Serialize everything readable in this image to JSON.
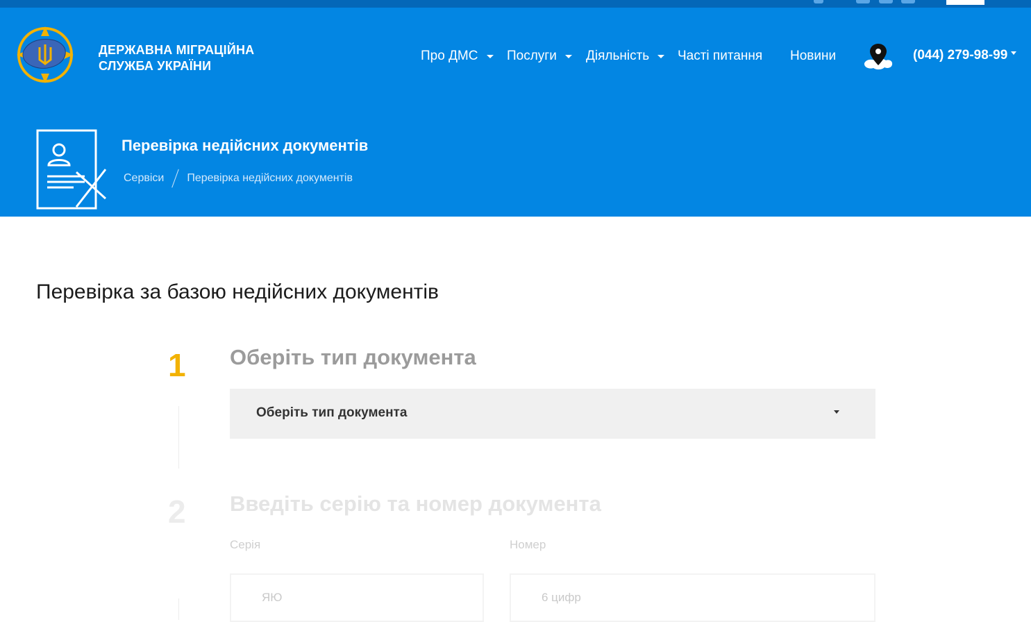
{
  "org": {
    "line1": "ДЕРЖАВНА МІГРАЦІЙНА",
    "line2": "СЛУЖБА УКРАЇНИ"
  },
  "nav": {
    "about": "Про ДМС",
    "services": "Послуги",
    "activity": "Діяльність",
    "faq": "Часті питання",
    "news": "Новини"
  },
  "phone": "(044) 279-98-99",
  "page": {
    "title": "Перевірка недійсних документів",
    "breadcrumbs": [
      "Сервіси",
      "Перевірка недійсних документів"
    ]
  },
  "section_title": "Перевірка за базою недійсних документів",
  "step1": {
    "number": "1",
    "title": "Оберіть тип документа",
    "select_value": "Оберіть тип документа"
  },
  "step2": {
    "number": "2",
    "title": "Введіть серію та номер документа",
    "series_label": "Серія",
    "series_placeholder": "ЯЮ",
    "number_label": "Номер",
    "number_placeholder": "6 цифр"
  },
  "colors": {
    "header_bg": "#0386e3",
    "top_bar": "#0467b8",
    "step_active": "#f2b203",
    "step_inactive": "#ececec"
  },
  "icons": [
    "coat-of-arms-logo",
    "map-pin-icon",
    "document-cancel-icon",
    "chevron-down-icon"
  ]
}
